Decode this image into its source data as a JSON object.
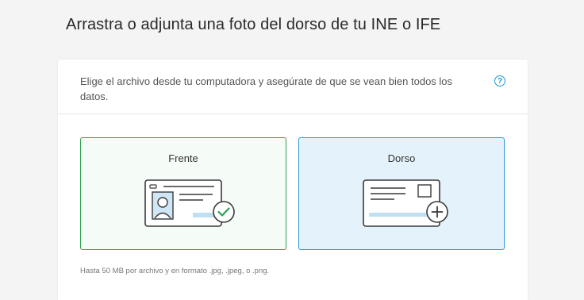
{
  "page": {
    "title": "Arrastra o adjunta una foto del dorso de tu INE o IFE"
  },
  "card": {
    "instructions": "Elige el archivo desde tu computadora y asegúrate de que se vean bien todos los datos.",
    "help_icon": "question-circle-icon",
    "help_glyph": "?",
    "options": [
      {
        "label": "Frente",
        "icon": "id-card-front-check-icon",
        "status": "uploaded",
        "accent": "#2aa351"
      },
      {
        "label": "Dorso",
        "icon": "id-card-back-add-icon",
        "status": "pending",
        "accent": "#2b98d6"
      }
    ],
    "footnote": "Hasta 50 MB por archivo y en formato .jpg, .jpeg, o .png."
  }
}
